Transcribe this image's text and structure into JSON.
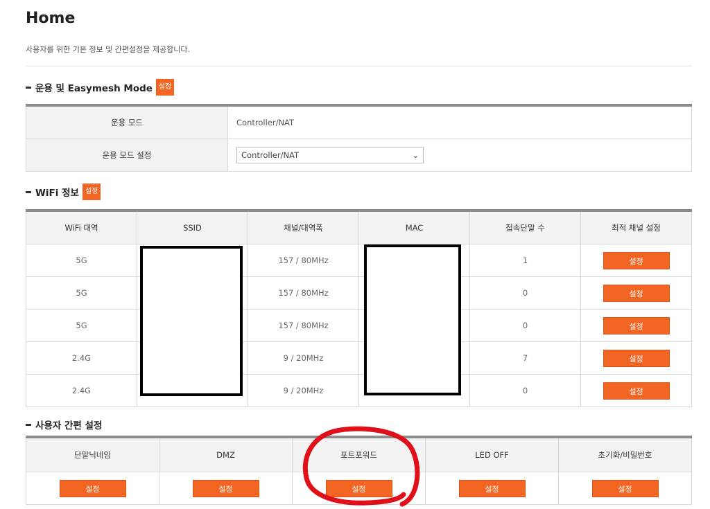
{
  "header": {
    "title": "Home",
    "description": "사용자를 위한 기본 정보 및 간편설정을 제공합니다."
  },
  "section_mode": {
    "title": "운용 및 Easymesh Mode",
    "button": "설정",
    "rows": [
      {
        "label": "운용 모드",
        "value": "Controller/NAT"
      },
      {
        "label": "운용 모드 설정",
        "select_value": "Controller/NAT"
      }
    ]
  },
  "section_wifi": {
    "title": "WiFi 정보",
    "button": "설정",
    "headers": [
      "WiFi 대역",
      "SSID",
      "채널/대역폭",
      "MAC",
      "접속단말 수",
      "최적 채널 설정"
    ],
    "rows": [
      {
        "band": "5G",
        "ssid": "",
        "channel": "157 / 80MHz",
        "mac": "",
        "clients": "1",
        "action": "설정"
      },
      {
        "band": "5G",
        "ssid": "",
        "channel": "157 / 80MHz",
        "mac": "",
        "clients": "0",
        "action": "설정"
      },
      {
        "band": "5G",
        "ssid": "",
        "channel": "157 / 80MHz",
        "mac": "",
        "clients": "0",
        "action": "설정"
      },
      {
        "band": "2.4G",
        "ssid": "",
        "channel": "9 / 20MHz",
        "mac": "",
        "clients": "7",
        "action": "설정"
      },
      {
        "band": "2.4G",
        "ssid": "",
        "channel": "9 / 20MHz",
        "mac": "",
        "clients": "0",
        "action": "설정"
      }
    ]
  },
  "section_quick": {
    "title": "사용자 간편 설정",
    "headers": [
      "단말닉네임",
      "DMZ",
      "포트포워드",
      "LED OFF",
      "초기화/비밀번호"
    ],
    "buttons": [
      "설정",
      "설정",
      "설정",
      "설정",
      "설정"
    ]
  },
  "colors": {
    "accent": "#f26522",
    "header_bg": "#f3f3f3",
    "table_top_border": "#8c8c8c",
    "annotation_circle": "#e0101a"
  }
}
